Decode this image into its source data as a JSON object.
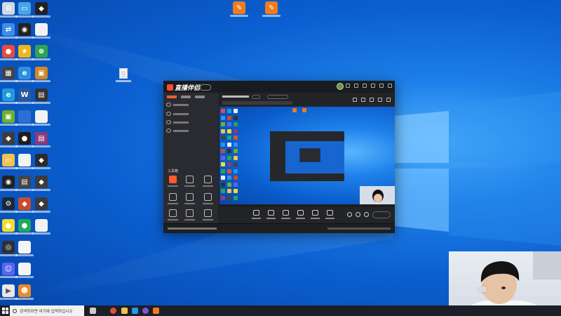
{
  "desktop": {
    "columns": [
      [
        {
          "icon": "recycle-bin-icon",
          "color": "#cfd8e6",
          "glyph": "♻"
        },
        {
          "icon": "network-icon",
          "color": "#3b8ee8",
          "glyph": "⇄"
        },
        {
          "icon": "chrome-icon",
          "color": "#e84b3b",
          "glyph": "●"
        },
        {
          "icon": "app-grid-icon",
          "color": "#444444",
          "glyph": "▦"
        },
        {
          "icon": "edge-icon",
          "color": "#1f9be0",
          "glyph": "e"
        },
        {
          "icon": "nvidia-icon",
          "color": "#6cb02b",
          "glyph": "▣"
        },
        {
          "icon": "game-icon",
          "color": "#3d3d3d",
          "glyph": "◆"
        },
        {
          "icon": "folder-icon",
          "color": "#f3c24b",
          "glyph": "▭"
        },
        {
          "icon": "camera-icon",
          "color": "#222222",
          "glyph": "◉"
        },
        {
          "icon": "steam-icon",
          "color": "#1b2838",
          "glyph": "⚙"
        },
        {
          "icon": "kakao-icon",
          "color": "#f5dc2b",
          "glyph": "●"
        },
        {
          "icon": "obs-icon",
          "color": "#302e31",
          "glyph": "◎"
        },
        {
          "icon": "discord-icon",
          "color": "#5865f2",
          "glyph": "☺"
        },
        {
          "icon": "media-icon",
          "color": "#e8e8e8",
          "glyph": "▶"
        }
      ],
      [
        {
          "icon": "computer-icon",
          "color": "#48a4e8",
          "glyph": "▭"
        },
        {
          "icon": "disc-icon",
          "color": "#222222",
          "glyph": "◉"
        },
        {
          "icon": "launcher-icon",
          "color": "#f0b51c",
          "glyph": "★"
        },
        {
          "icon": "ie-icon",
          "color": "#2e8fe0",
          "glyph": "e"
        },
        {
          "icon": "word-icon",
          "color": "#2b579a",
          "glyph": "W"
        },
        {
          "icon": "blank-icon",
          "color": "#2d6fd6",
          "glyph": ""
        },
        {
          "icon": "qq-icon",
          "color": "#1e1e1e",
          "glyph": "●"
        },
        {
          "icon": "file-icon",
          "color": "#f2f2f2",
          "glyph": ""
        },
        {
          "icon": "tool-icon",
          "color": "#444444",
          "glyph": "▤"
        },
        {
          "icon": "game-icon",
          "color": "#c74d2b",
          "glyph": "◆"
        },
        {
          "icon": "chat-icon",
          "color": "#1faa5b",
          "glyph": "●"
        },
        {
          "icon": "file-icon",
          "color": "#f5f5f5",
          "glyph": ""
        },
        {
          "icon": "file-icon",
          "color": "#f5f5f5",
          "glyph": ""
        },
        {
          "icon": "person-icon",
          "color": "#e88c2b",
          "glyph": "☻"
        }
      ],
      [
        {
          "icon": "game-icon",
          "color": "#222222",
          "glyph": "◆"
        },
        {
          "icon": "file-icon",
          "color": "#f2f2f2",
          "glyph": ""
        },
        {
          "icon": "map-icon",
          "color": "#2ea44f",
          "glyph": "⊕"
        },
        {
          "icon": "app-icon",
          "color": "#d08a25",
          "glyph": "▣"
        },
        {
          "icon": "app-icon",
          "color": "#333333",
          "glyph": "▤"
        },
        {
          "icon": "file-icon",
          "color": "#f2f2f2",
          "glyph": ""
        },
        {
          "icon": "winrar-icon",
          "color": "#8b3b7e",
          "glyph": "▤"
        },
        {
          "icon": "game-icon",
          "color": "#2b2b2b",
          "glyph": "◆"
        },
        {
          "icon": "game-icon",
          "color": "#3b3b3b",
          "glyph": "◆"
        },
        {
          "icon": "game-icon",
          "color": "#3a3a3a",
          "glyph": "◆"
        },
        {
          "icon": "file-icon",
          "color": "#f2f2f2",
          "glyph": ""
        }
      ]
    ],
    "top_icons": [
      {
        "icon": "streamer-app-icon",
        "color": "#f07b1e",
        "glyph": "✎"
      },
      {
        "icon": "streamer-app-icon",
        "color": "#f07b1e",
        "glyph": "✎"
      }
    ]
  },
  "app": {
    "logo": "直播伴侣",
    "toolbox_title": "工具箱",
    "accent": "#ff5b2e"
  },
  "taskbar": {
    "search_placeholder": "검색하려면 여기에 입력하십시오",
    "icons": [
      {
        "icon": "task-view-icon",
        "color": "#cccccc"
      },
      {
        "icon": "chrome-icon",
        "color": "#e84b3b"
      },
      {
        "icon": "explorer-icon",
        "color": "#f3c24b"
      },
      {
        "icon": "edge-icon",
        "color": "#1f9be0"
      },
      {
        "icon": "app-icon",
        "color": "#7b56d8"
      },
      {
        "icon": "streamer-app-icon",
        "color": "#f07b1e"
      }
    ]
  }
}
